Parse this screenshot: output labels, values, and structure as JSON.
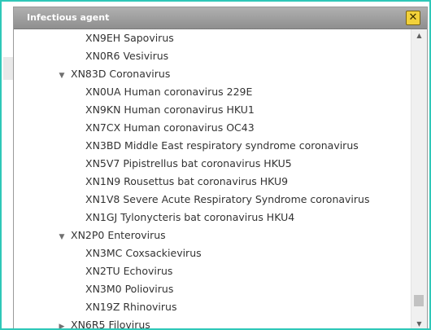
{
  "dialog": {
    "title": "Infectious agent",
    "close_label": "✕"
  },
  "tree": {
    "items": [
      {
        "label": "XN9EH Sapovirus",
        "level": 2,
        "toggle": ""
      },
      {
        "label": "XN0R6 Vesivirus",
        "level": 2,
        "toggle": ""
      },
      {
        "label": "XN83D Coronavirus",
        "level": 1,
        "toggle": "expanded"
      },
      {
        "label": "XN0UA Human coronavirus 229E",
        "level": 2,
        "toggle": ""
      },
      {
        "label": "XN9KN Human coronavirus HKU1",
        "level": 2,
        "toggle": ""
      },
      {
        "label": "XN7CX Human coronavirus OC43",
        "level": 2,
        "toggle": ""
      },
      {
        "label": "XN3BD Middle East respiratory syndrome coronavirus",
        "level": 2,
        "toggle": ""
      },
      {
        "label": "XN5V7 Pipistrellus bat coronavirus HKU5",
        "level": 2,
        "toggle": ""
      },
      {
        "label": "XN1N9 Rousettus bat coronavirus HKU9",
        "level": 2,
        "toggle": ""
      },
      {
        "label": "XN1V8 Severe Acute Respiratory Syndrome coronavirus",
        "level": 2,
        "toggle": ""
      },
      {
        "label": "XN1GJ Tylonycteris bat coronavirus HKU4",
        "level": 2,
        "toggle": ""
      },
      {
        "label": "XN2P0 Enterovirus",
        "level": 1,
        "toggle": "expanded"
      },
      {
        "label": "XN3MC Coxsackievirus",
        "level": 2,
        "toggle": ""
      },
      {
        "label": "XN2TU Echovirus",
        "level": 2,
        "toggle": ""
      },
      {
        "label": "XN3M0 Poliovirus",
        "level": 2,
        "toggle": ""
      },
      {
        "label": "XN19Z Rhinovirus",
        "level": 2,
        "toggle": ""
      },
      {
        "label": "XN6R5 Filovirus",
        "level": 1,
        "toggle": "collapsed"
      }
    ]
  },
  "icons": {
    "expanded": "triangle-down-icon",
    "collapsed": "triangle-right-icon",
    "close": "close-icon",
    "scroll_up": "chevron-up-icon",
    "scroll_down": "chevron-down-icon"
  },
  "colors": {
    "frame_border": "#2ec8b8",
    "titlebar": "#9f9f9f",
    "close_button": "#f2d13a",
    "text": "#333333"
  }
}
